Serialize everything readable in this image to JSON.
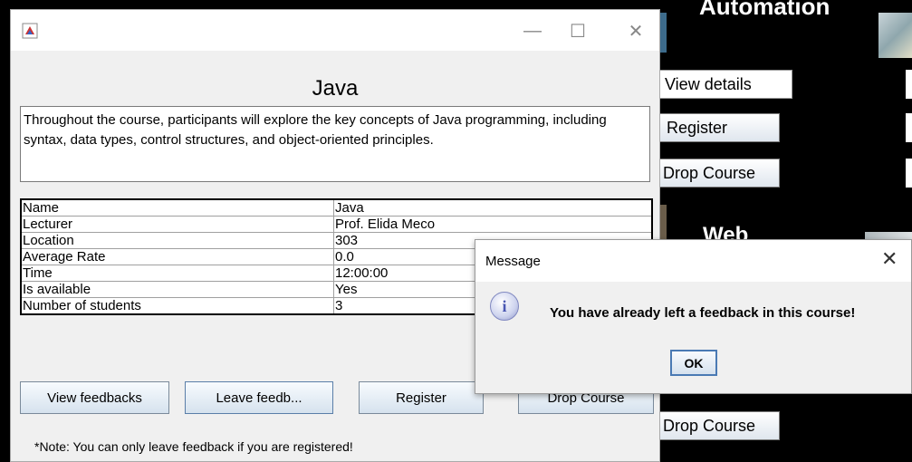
{
  "background": {
    "section1_title": "Automation",
    "section2_title": "Web",
    "view_details_label": "View details",
    "register_label": "Register",
    "drop_course_label": "Drop Course",
    "drop_course_label_2": "Drop Course"
  },
  "window": {
    "course_title": "Java",
    "description": "Throughout the course, participants will explore the key concepts of Java programming, including syntax, data types, control structures, and object-oriented principles.",
    "table": [
      {
        "key": "Name",
        "value": "Java"
      },
      {
        "key": "Lecturer",
        "value": "Prof. Elida Meco"
      },
      {
        "key": "Location",
        "value": "303"
      },
      {
        "key": "Average Rate",
        "value": "0.0"
      },
      {
        "key": "Time",
        "value": "12:00:00"
      },
      {
        "key": "Is available",
        "value": "Yes"
      },
      {
        "key": "Number of students",
        "value": "3"
      }
    ],
    "buttons": {
      "view_feedbacks": "View feedbacks",
      "leave_feedback": "Leave feedb...",
      "register": "Register",
      "drop_course": "Drop Course"
    },
    "note": "*Note: You can only leave feedback if you are registered!"
  },
  "dialog": {
    "title": "Message",
    "message": "You have already left a feedback in this course!",
    "ok_label": "OK",
    "icon": "info-icon"
  }
}
